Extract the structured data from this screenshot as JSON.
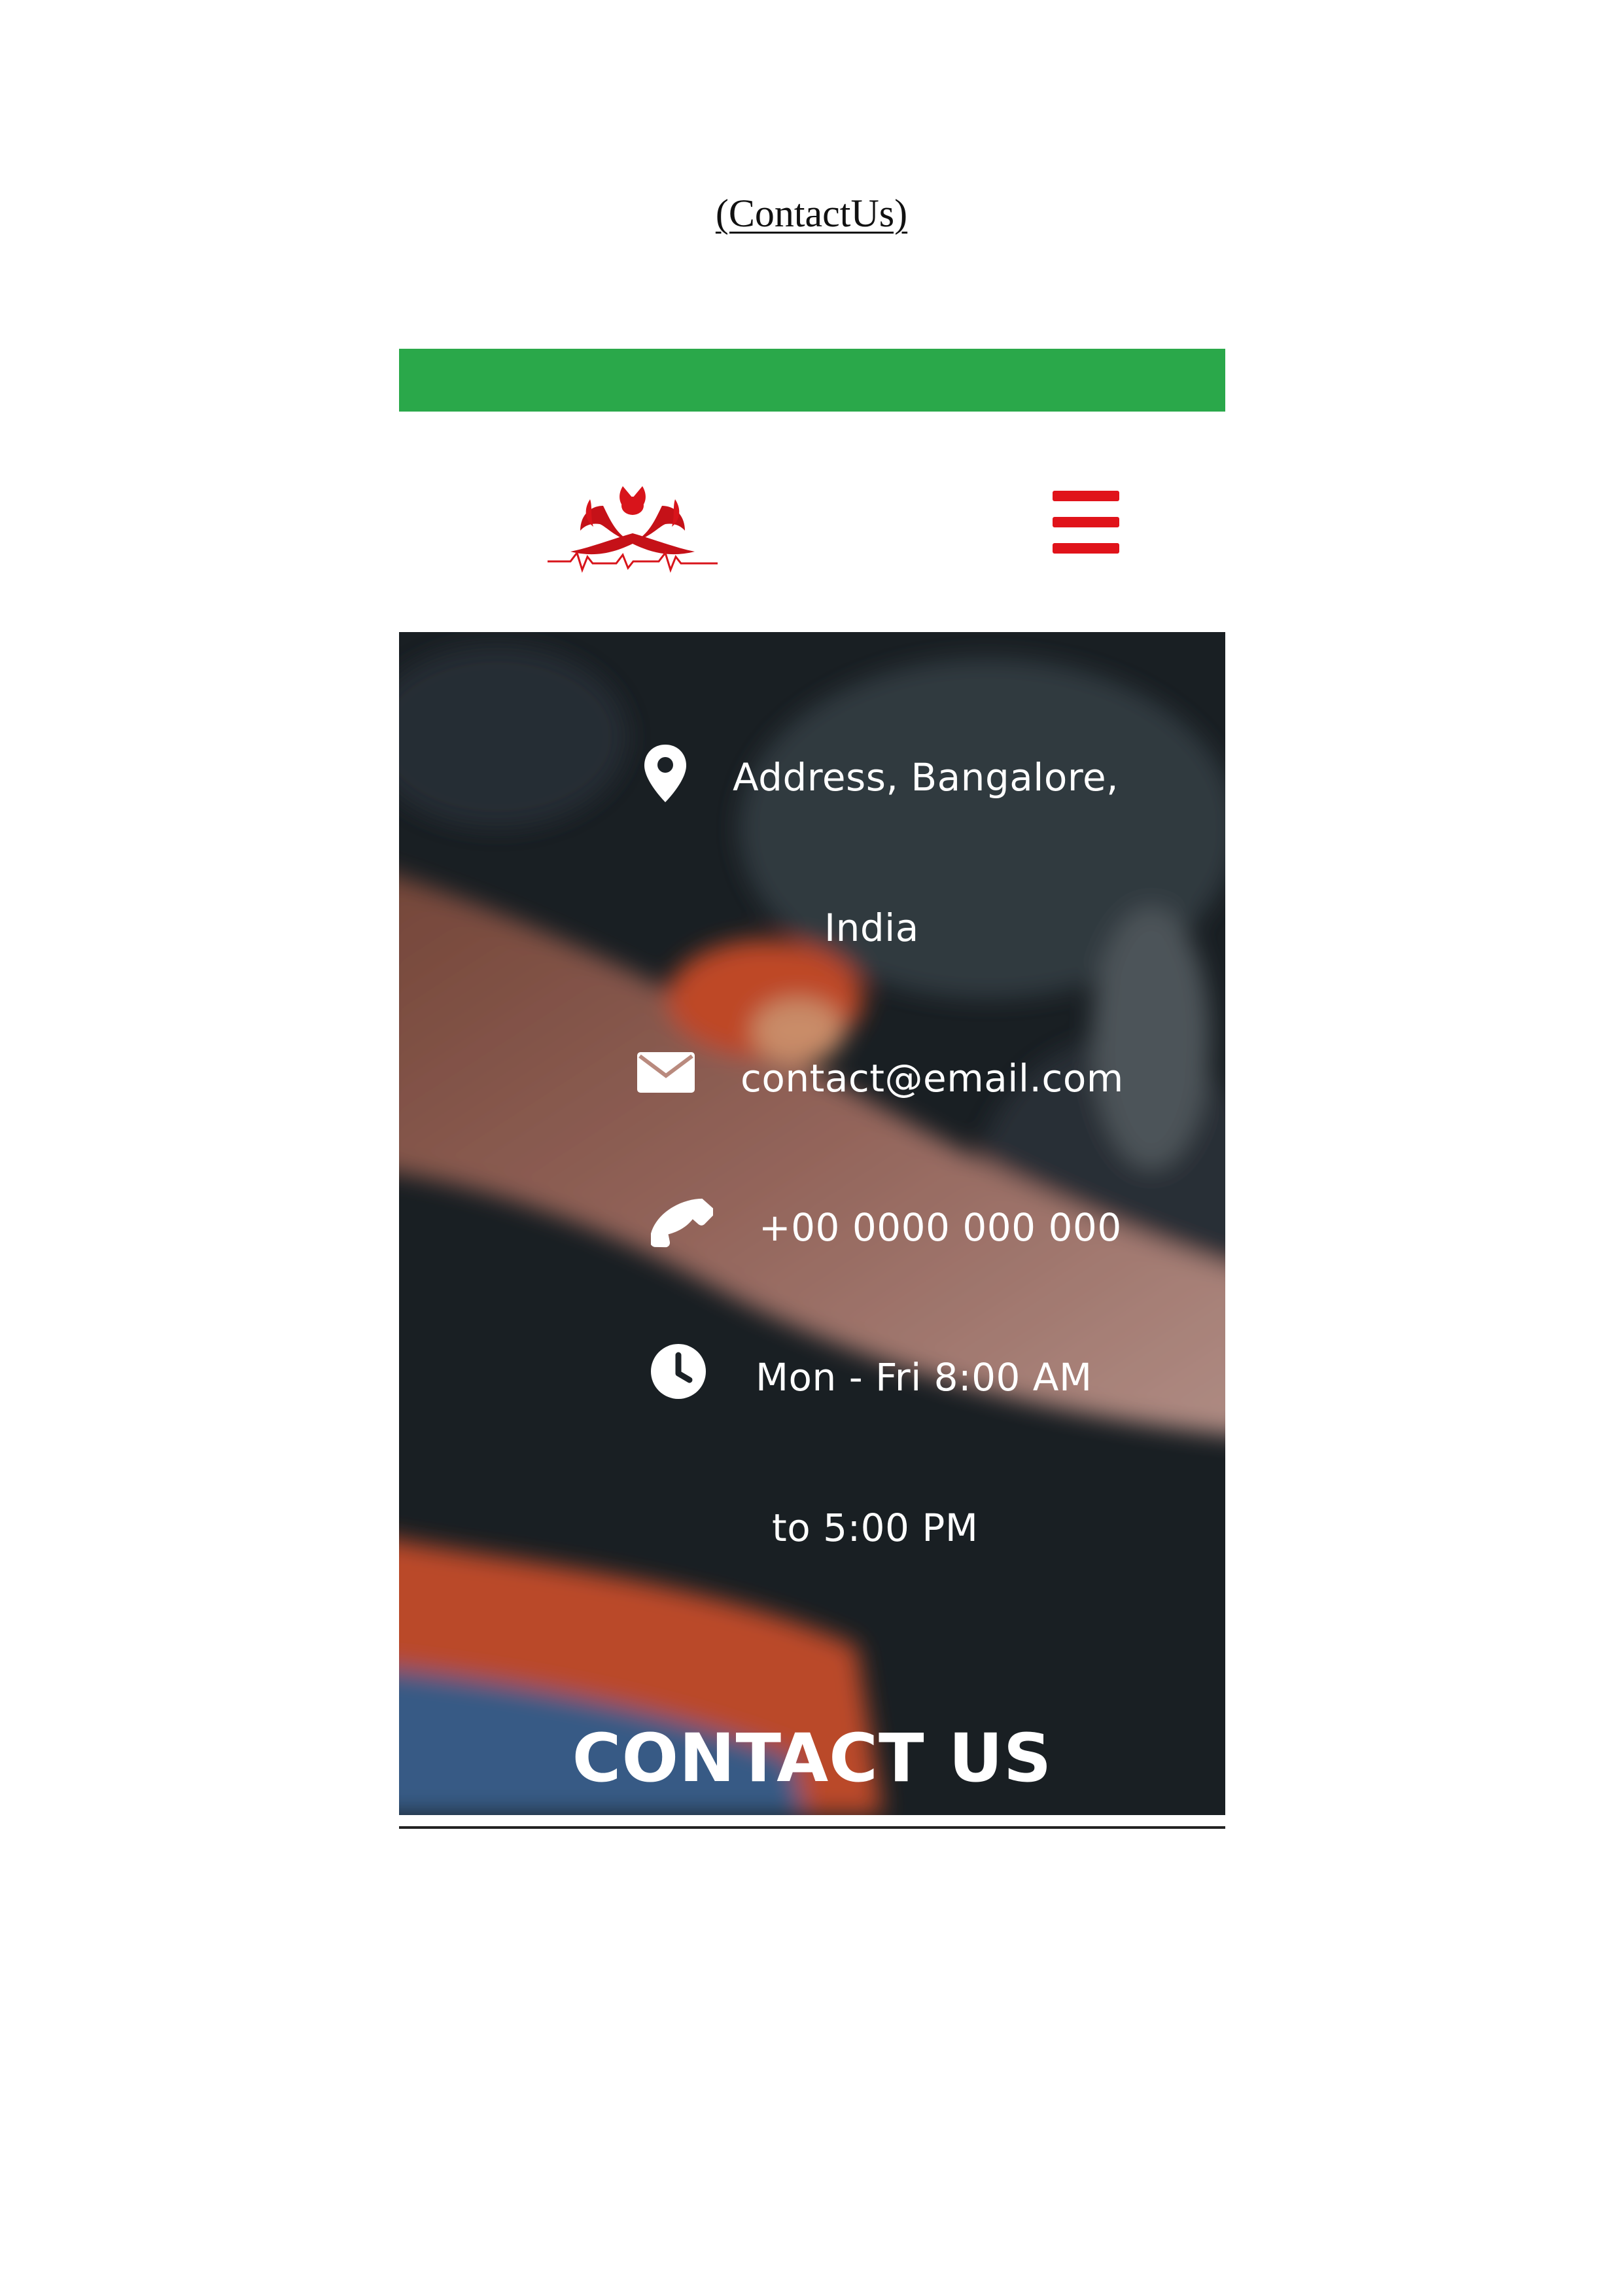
{
  "caption": "(ContactUs)",
  "colors": {
    "top_bar": "#2aa84a",
    "brand_red": "#e0131a",
    "hero_dark": "#1b2126",
    "text_white": "#ffffff"
  },
  "header": {
    "logo_icon": "blood-drop-hands-logo",
    "menu_icon": "hamburger-menu-icon"
  },
  "contact": {
    "address_line1": "Address, Bangalore,",
    "address_line2": "India",
    "email": "contact@email.com",
    "phone": "+00 0000 000 000",
    "hours_line1": "Mon - Fri 8:00 AM",
    "hours_line2": "to 5:00 PM",
    "icons": [
      "map-pin-icon",
      "envelope-icon",
      "phone-icon",
      "clock-icon"
    ]
  },
  "hero": {
    "title": "CONTACT US"
  }
}
